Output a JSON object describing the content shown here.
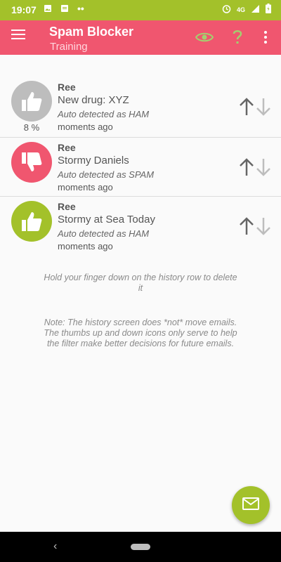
{
  "status_bar": {
    "time": "19:07",
    "network": "4G"
  },
  "app_bar": {
    "title": "Spam Blocker",
    "subtitle": "Training",
    "icons": [
      "menu-icon",
      "eye-icon",
      "help-icon",
      "more-vert-icon"
    ]
  },
  "history": [
    {
      "sender": "Ree",
      "subject": "New drug: XYZ",
      "detection": "Auto detected as HAM",
      "time": "moments ago",
      "percent": "8 %",
      "badge": "thumbs-up-icon",
      "badge_color": "#bdbdbd"
    },
    {
      "sender": "Ree",
      "subject": "Stormy Daniels",
      "detection": "Auto detected as SPAM",
      "time": "moments ago",
      "badge": "thumbs-down-icon",
      "badge_color": "#f0566f"
    },
    {
      "sender": "Ree",
      "subject": "Stormy at Sea Today",
      "detection": "Auto detected as HAM",
      "time": "moments ago",
      "badge": "thumbs-up-icon",
      "badge_color": "#a3c12a"
    }
  ],
  "hint": "Hold your finger down on the history row to delete it",
  "note": "Note: The history screen does *not* move emails. The thumbs up and down icons only serve to help the filter make better decisions for future emails.",
  "colors": {
    "accent_green": "#a3c12a",
    "accent_pink": "#f0566f"
  }
}
